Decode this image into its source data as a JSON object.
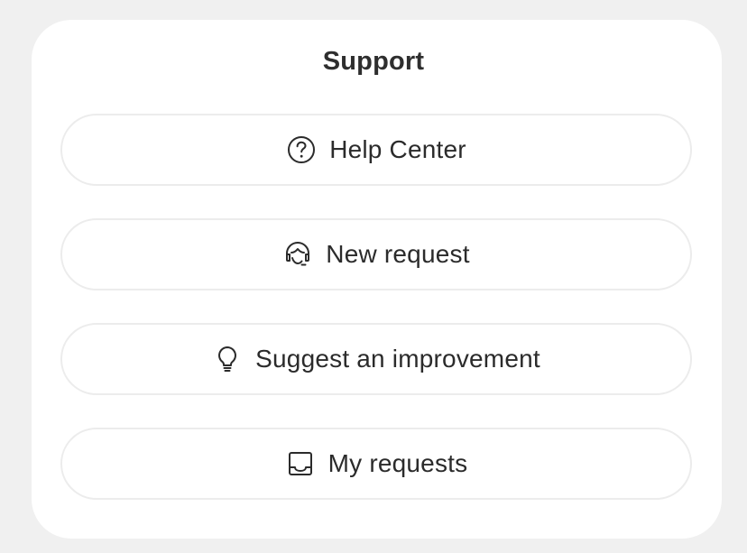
{
  "dialog": {
    "title": "Support"
  },
  "buttons": [
    {
      "label": "Help Center",
      "icon": "help-circle-icon"
    },
    {
      "label": "New request",
      "icon": "support-agent-icon"
    },
    {
      "label": "Suggest an improvement",
      "icon": "lightbulb-icon"
    },
    {
      "label": "My requests",
      "icon": "inbox-tray-icon"
    }
  ]
}
